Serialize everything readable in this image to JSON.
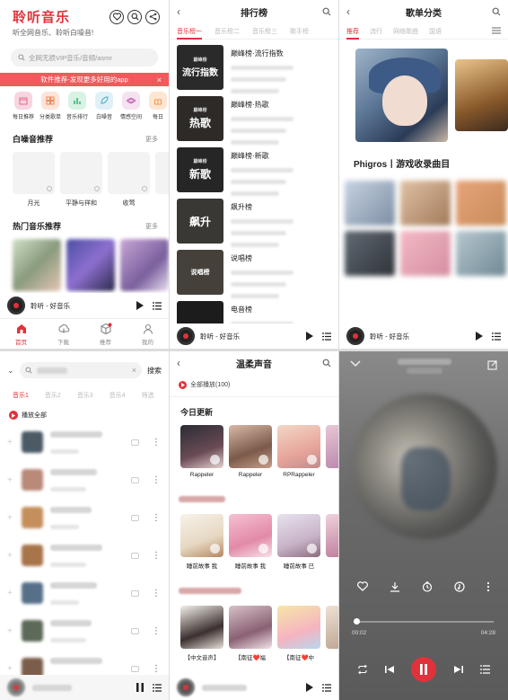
{
  "home": {
    "app_title": "聆听音乐",
    "subtitle": "听全网音乐、聆听白噪音!",
    "search_placeholder": "全网无损VIP音乐/音频/asmr",
    "banner_text": "软件推荐-发现更多好用的app",
    "banner_close": "×",
    "quick": [
      {
        "label": "每日推荐",
        "icon": "calendar-icon",
        "color": "#f7d6e0"
      },
      {
        "label": "分类歌单",
        "icon": "grid-icon",
        "color": "#fde3d8"
      },
      {
        "label": "音乐排行",
        "icon": "chart-icon",
        "color": "#d8f2e4"
      },
      {
        "label": "白噪音",
        "icon": "leaf-icon",
        "color": "#dff1f7"
      },
      {
        "label": "情感空间",
        "icon": "planet-icon",
        "color": "#f5e2f0"
      },
      {
        "label": "每日",
        "icon": "gift-icon",
        "color": "#fde6d2"
      }
    ],
    "white_noise_title": "白噪音推荐",
    "more_label": "更多",
    "white_noise": [
      "月光",
      "平静与祥和",
      "收莺",
      "镜"
    ],
    "hot_title": "热门音乐推荐",
    "hot_more": "更多",
    "player_title": "聆听 - 好音乐",
    "tabs": [
      {
        "label": "首页",
        "icon": "home-icon",
        "active": true
      },
      {
        "label": "下载",
        "icon": "cloud-icon",
        "active": false
      },
      {
        "label": "推荐",
        "icon": "cube-icon",
        "active": false
      },
      {
        "label": "我的",
        "icon": "user-icon",
        "active": false
      }
    ]
  },
  "rank": {
    "title": "排行榜",
    "tabs": [
      "音乐榜一",
      "音乐榜二",
      "音乐榜三",
      "歌手榜"
    ],
    "items": [
      {
        "cover": "流行指数",
        "name": "巅峰榜·流行指数"
      },
      {
        "cover": "热歌",
        "name": "巅峰榜·热歌"
      },
      {
        "cover": "新歌",
        "name": "巅峰榜·新歌"
      },
      {
        "cover": "飙升",
        "name": "飙升榜"
      },
      {
        "cover": "说唱榜",
        "name": "说唱榜"
      },
      {
        "cover": "",
        "name": "电音榜"
      }
    ],
    "cover_badge": "巅峰榜",
    "player_title": "聆听 - 好音乐"
  },
  "category": {
    "title": "歌单分类",
    "tabs": [
      "推荐",
      "流行",
      "网络歌曲",
      "国语"
    ],
    "playlist_title": "Phigros丨游戏收录曲目"
  },
  "search": {
    "search_button": "搜索",
    "tabs": [
      "音乐1",
      "音乐2",
      "音乐3",
      "音乐4",
      "筛选"
    ],
    "play_all": "播放全部",
    "row_count": 7
  },
  "gentle": {
    "title": "温柔声音",
    "play_all": "全部播放(100)",
    "today_title": "今日更新",
    "row1": [
      "Rappeler",
      "Rappeler",
      "RPRappeler",
      "Char"
    ],
    "row2": [
      "睡前故事 我",
      "睡前故事 我",
      "睡前故事 已",
      "睡前"
    ],
    "row3": [
      "【中文音声】",
      "【南征❤️福",
      "【南征❤️中",
      "【中"
    ]
  },
  "now_playing": {
    "elapsed": "00:02",
    "duration": "04:28",
    "progress": 0.02
  }
}
